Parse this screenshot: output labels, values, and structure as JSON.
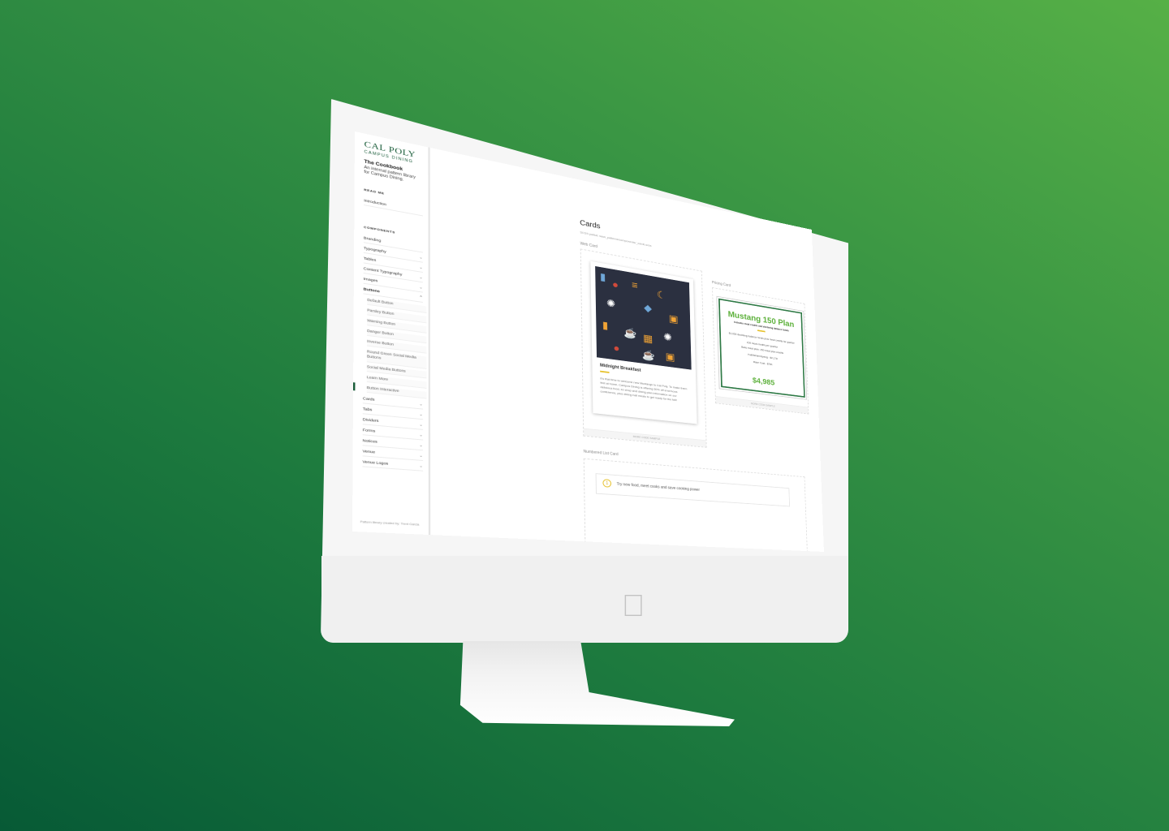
{
  "sidebar": {
    "logo_line1": "CAL POLY",
    "logo_line2": "CAMPUS DINING",
    "title": "The Cookbook",
    "description": "An internal pattern library for Campus Dining.",
    "readme_heading": "READ ME",
    "intro": "Introduction",
    "components_heading": "COMPONENTS",
    "items": [
      {
        "label": "Branding"
      },
      {
        "label": "Typography"
      },
      {
        "label": "Tables"
      },
      {
        "label": "Content Typography"
      },
      {
        "label": "Images"
      },
      {
        "label": "Buttons"
      }
    ],
    "button_subitems": [
      {
        "label": "Default Button"
      },
      {
        "label": "Parsley Button"
      },
      {
        "label": "Warning Button"
      },
      {
        "label": "Danger Button"
      },
      {
        "label": "Inverse Button"
      },
      {
        "label": "Round Green Social Media Buttons"
      },
      {
        "label": "Social Media Buttons"
      },
      {
        "label": "Learn More"
      },
      {
        "label": "Button Interactive"
      }
    ],
    "items_after": [
      {
        "label": "Cards"
      },
      {
        "label": "Tabs"
      },
      {
        "label": "Dividers"
      },
      {
        "label": "Forms"
      },
      {
        "label": "Notices"
      },
      {
        "label": "Venue"
      },
      {
        "label": "Venue Logos"
      }
    ],
    "footer": "Pattern library created by: Trent Garcia"
  },
  "content": {
    "title": "Cards",
    "path": "SCSS partial: sass_patterns/components/_cards.scss",
    "web_card_label": "Web Card",
    "pricing_card_label": "Pricing Card",
    "numbered_label": "Numbered List Card",
    "web_card": {
      "title": "Midnight Breakfast",
      "text": "It's that time to welcome new Mustangs to Cal Poly. To make them feel at home, Campus Dining is offering 50% off enormous delicious food, so shop and dining plan information on our conference, plus dining hall meals to get ready for the fall!",
      "footer": "MORE CODE SAMPLE"
    },
    "pricing_card": {
      "title": "Mustang 150 Plan",
      "subtitle": "Includes meal credits and declining balance funds",
      "rows": [
        "$1,050 declining balance funds plus meal credits for quarter",
        "150 meal credits per quarter",
        "Base meal plan: 150 meal plan credits",
        "Fall/Winter/Spring - $2,178",
        "Base Cost - $781"
      ],
      "price": "$4,985",
      "footer": "MORE CODE SAMPLE"
    },
    "numbered_item": {
      "number": "1",
      "text": "Try new food, meet cooks and save cooking power"
    }
  },
  "colors": {
    "brand_green": "#1a5d3a",
    "accent_green": "#5cb03a",
    "accent_yellow": "#e6c12b"
  }
}
